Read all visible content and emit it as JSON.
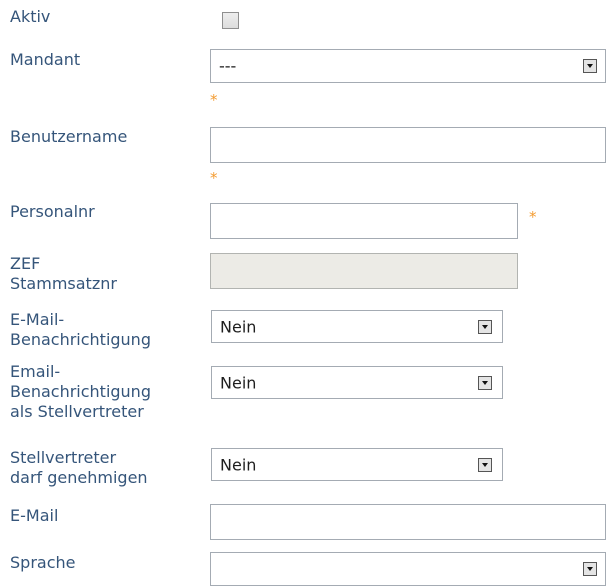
{
  "labels": {
    "aktiv": "Aktiv",
    "mandant": "Mandant",
    "benutzername": "Benutzername",
    "personalnr": "Personalnr",
    "zef_line1": "ZEF",
    "zef_line2": "Stammsatznr",
    "email_benachr_line1": "E-Mail-",
    "email_benachr_line2": "Benachrichtigung",
    "email_stell_line1": "Email-",
    "email_stell_line2": "Benachrichtigung",
    "email_stell_line3": "als Stellvertreter",
    "stell_gen_line1": "Stellvertreter",
    "stell_gen_line2": "darf genehmigen",
    "email": "E-Mail",
    "sprache": "Sprache"
  },
  "required_marker": "*",
  "fields": {
    "aktiv_checked": false,
    "mandant_value": "---",
    "benutzername_value": "",
    "personalnr_value": "",
    "zef_value": "",
    "email_benachr_value": "Nein",
    "email_stell_value": "Nein",
    "stell_gen_value": "Nein",
    "email_value": "",
    "sprache_value": ""
  },
  "icons": {
    "dropdown": "chevron-down-icon",
    "required": "asterisk-icon"
  },
  "colors": {
    "label": "#35557a",
    "required": "#f39c32",
    "border": "#a4abb3",
    "disabled_bg": "#ecebe6"
  }
}
